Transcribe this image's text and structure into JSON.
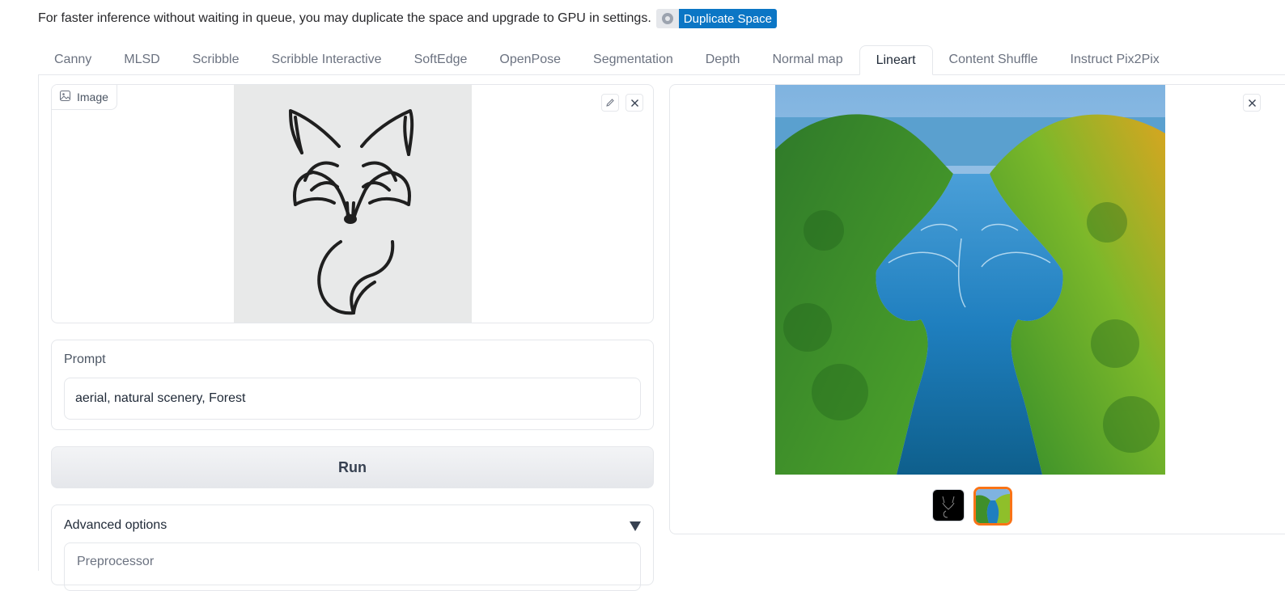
{
  "notice": {
    "text": "For faster inference without waiting in queue, you may duplicate the space and upgrade to GPU in settings.",
    "badge_icon": "duplicate-icon",
    "duplicate_label": "Duplicate Space"
  },
  "tabs": [
    {
      "label": "Canny",
      "active": false
    },
    {
      "label": "MLSD",
      "active": false
    },
    {
      "label": "Scribble",
      "active": false
    },
    {
      "label": "Scribble Interactive",
      "active": false
    },
    {
      "label": "SoftEdge",
      "active": false
    },
    {
      "label": "OpenPose",
      "active": false
    },
    {
      "label": "Segmentation",
      "active": false
    },
    {
      "label": "Depth",
      "active": false
    },
    {
      "label": "Normal map",
      "active": false
    },
    {
      "label": "Lineart",
      "active": true
    },
    {
      "label": "Content Shuffle",
      "active": false
    },
    {
      "label": "Instruct Pix2Pix",
      "active": false
    }
  ],
  "input_image": {
    "label": "Image",
    "icon": "image-icon",
    "edit_icon": "pencil-icon",
    "clear_icon": "close-icon",
    "content": "line drawing of a fox"
  },
  "prompt": {
    "label": "Prompt",
    "value": "aerial,  natural scenery, Forest"
  },
  "run_label": "Run",
  "advanced": {
    "label": "Advanced options",
    "preprocessor_label": "Preprocessor"
  },
  "output": {
    "close_icon": "close-icon",
    "selected_index": 1,
    "thumbnails": [
      "fox lineart on black",
      "forest river aerial"
    ]
  },
  "colors": {
    "accent": "#f97316",
    "duplicate_button": "#0b76c5"
  }
}
